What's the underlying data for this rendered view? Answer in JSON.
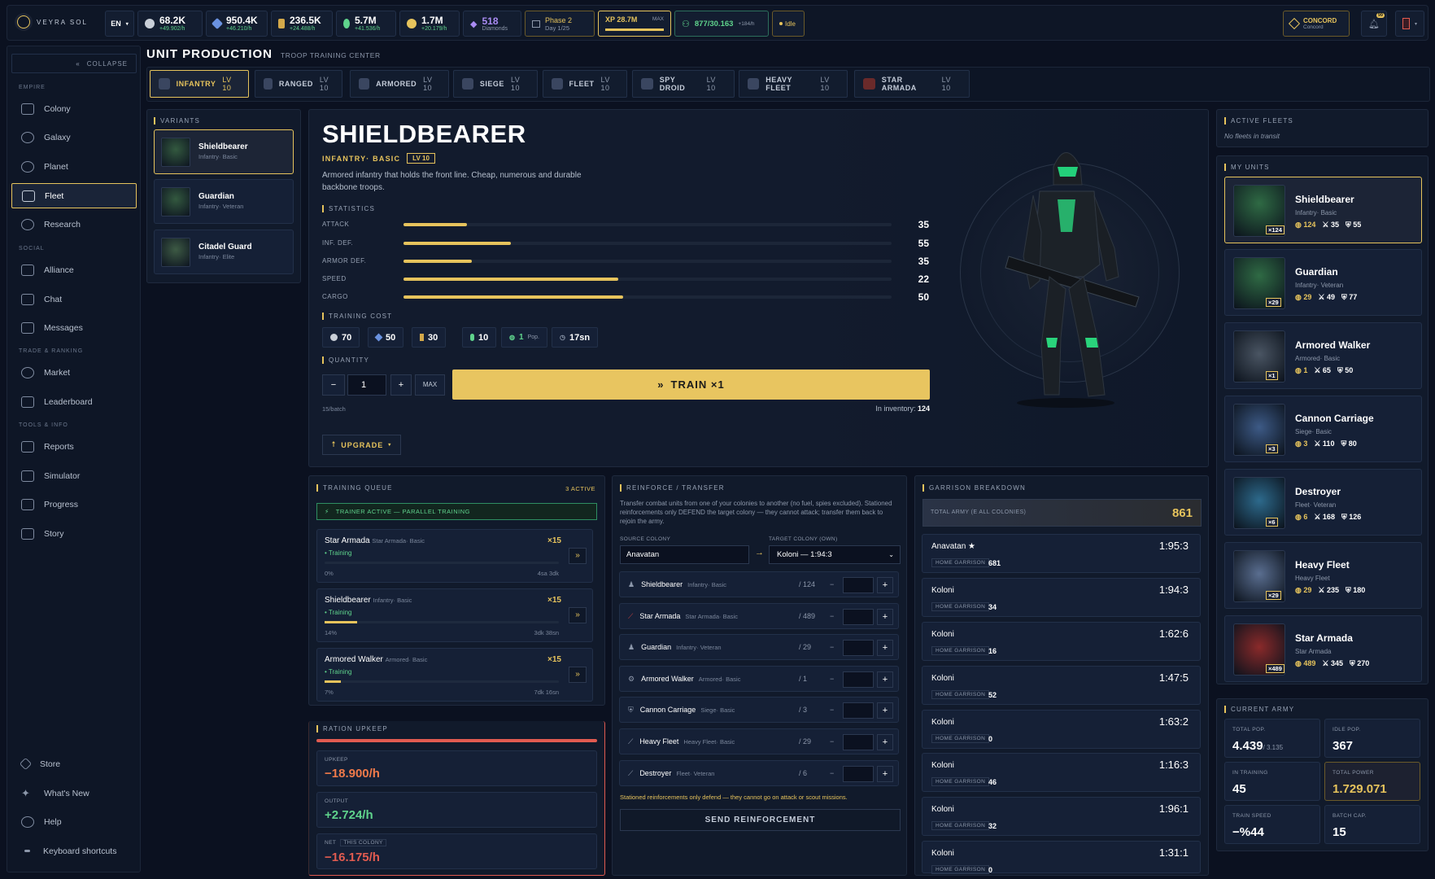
{
  "brand": "VEYRA SOL",
  "lang": "EN",
  "resources": [
    {
      "icon": "metal-icon",
      "value": "68.2K",
      "rate": "+49.902/h"
    },
    {
      "icon": "crystal-icon",
      "value": "950.4K",
      "rate": "+46.210/h"
    },
    {
      "icon": "ration-icon",
      "value": "236.5K",
      "rate": "+24.488/h"
    },
    {
      "icon": "energy-icon",
      "value": "5.7M",
      "rate": "+41.536/h"
    },
    {
      "icon": "gold-icon",
      "value": "1.7M",
      "rate": "+20.179/h"
    }
  ],
  "diamonds": {
    "value": "518",
    "label": "Diamonds"
  },
  "phase": {
    "title": "Phase 2",
    "day": "Day 1/25"
  },
  "xp": {
    "value": "XP 28.7M",
    "max": "MAX",
    "progress": 1.0
  },
  "population": {
    "value": "877/30.163",
    "rate": "+184/h"
  },
  "idle": "Idle",
  "concord": {
    "title": "CONCORD",
    "sub": "Concord"
  },
  "notif_badge": "99",
  "sidebar": {
    "collapse": "COLLAPSE",
    "groups": {
      "empire": "EMPIRE",
      "social": "SOCIAL",
      "trade": "TRADE & RANKING",
      "tools": "TOOLS & INFO"
    },
    "items": [
      "Colony",
      "Galaxy",
      "Planet",
      "Fleet",
      "Research",
      "Alliance",
      "Chat",
      "Messages",
      "Market",
      "Leaderboard",
      "Reports",
      "Simulator",
      "Progress",
      "Story",
      "Store",
      "What's New",
      "Help",
      "Keyboard shortcuts"
    ]
  },
  "page": {
    "title": "UNIT PRODUCTION",
    "subtitle": "TROOP TRAINING CENTER"
  },
  "tabs": [
    {
      "label": "INFANTRY",
      "lv": "LV 10"
    },
    {
      "label": "RANGED",
      "lv": "LV 10"
    },
    {
      "label": "ARMORED",
      "lv": "LV 10"
    },
    {
      "label": "SIEGE",
      "lv": "LV 10"
    },
    {
      "label": "FLEET",
      "lv": "LV 10"
    },
    {
      "label": "SPY DROID",
      "lv": "LV 10"
    },
    {
      "label": "HEAVY FLEET",
      "lv": "LV 10"
    },
    {
      "label": "STAR ARMADA",
      "lv": "LV 10"
    }
  ],
  "variants": {
    "title": "VARIANTS",
    "items": [
      {
        "name": "Shieldbearer",
        "type": "Infantry· Basic"
      },
      {
        "name": "Guardian",
        "type": "Infantry· Veteran"
      },
      {
        "name": "Citadel Guard",
        "type": "Infantry· Elite"
      }
    ]
  },
  "unit": {
    "name": "SHIELDBEARER",
    "type": "INFANTRY· BASIC",
    "lv": "LV 10",
    "desc": "Armored infantry that holds the front line. Cheap, numerous and durable backbone troops.",
    "stats_title": "STATISTICS",
    "stats": [
      {
        "label": "ATTACK",
        "value": "35",
        "fill": 0.13
      },
      {
        "label": "INF. DEF.",
        "value": "55",
        "fill": 0.22
      },
      {
        "label": "ARMOR DEF.",
        "value": "35",
        "fill": 0.14
      },
      {
        "label": "SPEED",
        "value": "22",
        "fill": 0.44
      },
      {
        "label": "CARGO",
        "value": "50",
        "fill": 0.45
      }
    ],
    "cost_title": "TRAINING COST",
    "costs": [
      {
        "v": "70"
      },
      {
        "v": "50"
      },
      {
        "v": "30"
      },
      {
        "v": "10"
      },
      {
        "v": "1",
        "u": "Pop."
      },
      {
        "v": "17sn"
      }
    ],
    "qty_title": "QUANTITY",
    "qty": "1",
    "max": "MAX",
    "batch": "15/batch",
    "train": "TRAIN ×1",
    "inventory": "In inventory:",
    "inventory_v": "124",
    "upgrade": "UPGRADE"
  },
  "queue": {
    "title": "TRAINING QUEUE",
    "active": "3 ACTIVE",
    "trainer": "TRAINER ACTIVE — PARALLEL TRAINING",
    "items": [
      {
        "name": "Star Armada",
        "type": "Star Armada· Basic",
        "x": "×15",
        "status": "Training",
        "pct": "0%",
        "time": "4sa 3dk",
        "fill": 0.0
      },
      {
        "name": "Shieldbearer",
        "type": "Infantry· Basic",
        "x": "×15",
        "status": "Training",
        "pct": "14%",
        "time": "3dk 38sn",
        "fill": 0.14
      },
      {
        "name": "Armored Walker",
        "type": "Armored· Basic",
        "x": "×15",
        "status": "Training",
        "pct": "7%",
        "time": "7dk 16sn",
        "fill": 0.07
      }
    ]
  },
  "ration": {
    "title": "RATION UPKEEP",
    "upkeep_l": "UPKEEP",
    "upkeep": "−18.900/h",
    "output_l": "OUTPUT",
    "output": "+2.724/h",
    "net_l": "NET",
    "net_tag": "THIS COLONY",
    "net": "−16.175/h"
  },
  "reinforce": {
    "title": "REINFORCE / TRANSFER",
    "desc": "Transfer combat units from one of your colonies to another (no fuel, spies excluded). Stationed reinforcements only DEFEND the target colony — they cannot attack; transfer them back to rejoin the army.",
    "source_l": "SOURCE COLONY",
    "source": "Anavatan",
    "target_l": "TARGET COLONY (OWN)",
    "target": "Koloni — 1:94:3",
    "rows": [
      {
        "name": "Shieldbearer",
        "type": "Infantry· Basic",
        "c": "/ 124"
      },
      {
        "name": "Star Armada",
        "type": "Star Armada· Basic",
        "c": "/ 489"
      },
      {
        "name": "Guardian",
        "type": "Infantry· Veteran",
        "c": "/ 29"
      },
      {
        "name": "Armored Walker",
        "type": "Armored· Basic",
        "c": "/ 1"
      },
      {
        "name": "Cannon Carriage",
        "type": "Siege· Basic",
        "c": "/ 3"
      },
      {
        "name": "Heavy Fleet",
        "type": "Heavy Fleet· Basic",
        "c": "/ 29"
      },
      {
        "name": "Destroyer",
        "type": "Fleet· Veteran",
        "c": "/ 6"
      }
    ],
    "note": "Stationed reinforcements only defend — they cannot go on attack or scout missions.",
    "send": "SEND REINFORCEMENT"
  },
  "garrison": {
    "title": "GARRISON BREAKDOWN",
    "total_l": "TOTAL ARMY (E ALL COLONIES)",
    "total": "861",
    "hg": "HOME GARRISON",
    "rows": [
      {
        "n": "Anavatan ★",
        "c": "1:95:3",
        "v": "681"
      },
      {
        "n": "Koloni",
        "c": "1:94:3",
        "v": "34"
      },
      {
        "n": "Koloni",
        "c": "1:62:6",
        "v": "16"
      },
      {
        "n": "Koloni",
        "c": "1:47:5",
        "v": "52"
      },
      {
        "n": "Koloni",
        "c": "1:63:2",
        "v": "0"
      },
      {
        "n": "Koloni",
        "c": "1:16:3",
        "v": "46"
      },
      {
        "n": "Koloni",
        "c": "1:96:1",
        "v": "32"
      },
      {
        "n": "Koloni",
        "c": "1:31:1",
        "v": "0"
      }
    ]
  },
  "fleets": {
    "title": "ACTIVE FLEETS",
    "empty": "No fleets in transit"
  },
  "my_units": {
    "title": "MY UNITS",
    "items": [
      {
        "name": "Shieldbearer",
        "type": "Infantry· Basic",
        "badge": "×124",
        "s": [
          "124",
          "35",
          "55"
        ]
      },
      {
        "name": "Guardian",
        "type": "Infantry· Veteran",
        "badge": "×29",
        "s": [
          "29",
          "49",
          "77"
        ]
      },
      {
        "name": "Armored Walker",
        "type": "Armored· Basic",
        "badge": "×1",
        "s": [
          "1",
          "65",
          "50"
        ]
      },
      {
        "name": "Cannon Carriage",
        "type": "Siege· Basic",
        "badge": "×3",
        "s": [
          "3",
          "110",
          "80"
        ]
      },
      {
        "name": "Destroyer",
        "type": "Fleet· Veteran",
        "badge": "×6",
        "s": [
          "6",
          "168",
          "126"
        ]
      },
      {
        "name": "Heavy Fleet",
        "type": "Heavy Fleet",
        "badge": "×29",
        "s": [
          "29",
          "235",
          "180"
        ]
      },
      {
        "name": "Star Armada",
        "type": "Star Armada",
        "badge": "×489",
        "s": [
          "489",
          "345",
          "270"
        ]
      }
    ]
  },
  "army": {
    "title": "CURRENT ARMY",
    "tiles": [
      {
        "l": "TOTAL POP.",
        "v": "4.439",
        "x": "/ 3.135"
      },
      {
        "l": "IDLE POP.",
        "v": "367"
      },
      {
        "l": "IN TRAINING",
        "v": "45"
      },
      {
        "l": "TOTAL POWER",
        "v": "1.729.071"
      },
      {
        "l": "TRAIN SPEED",
        "v": "−%44"
      },
      {
        "l": "BATCH CAP.",
        "v": "15"
      }
    ]
  }
}
